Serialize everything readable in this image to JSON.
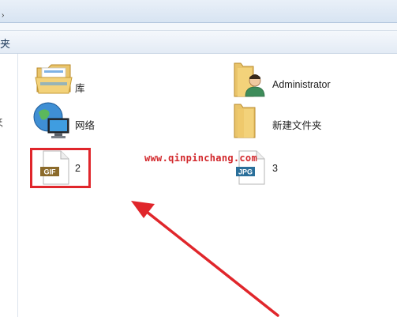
{
  "toolbar": {
    "label": "夹"
  },
  "navpane": {
    "glyph": "ξ"
  },
  "items": [
    {
      "name": "库",
      "icon": "library-folder-icon"
    },
    {
      "name": "Administrator",
      "icon": "user-folder-icon"
    },
    {
      "name": "网络",
      "icon": "network-globe-icon"
    },
    {
      "name": "新建文件夹",
      "icon": "folder-icon"
    },
    {
      "name": "2",
      "icon": "gif-file-icon",
      "badge": "GIF"
    },
    {
      "name": "3",
      "icon": "jpg-file-icon",
      "badge": "JPG"
    }
  ],
  "watermark": "www.qinpinchang.com",
  "colors": {
    "annotation": "#e0262b",
    "toolbar": "#e3ebf5"
  }
}
